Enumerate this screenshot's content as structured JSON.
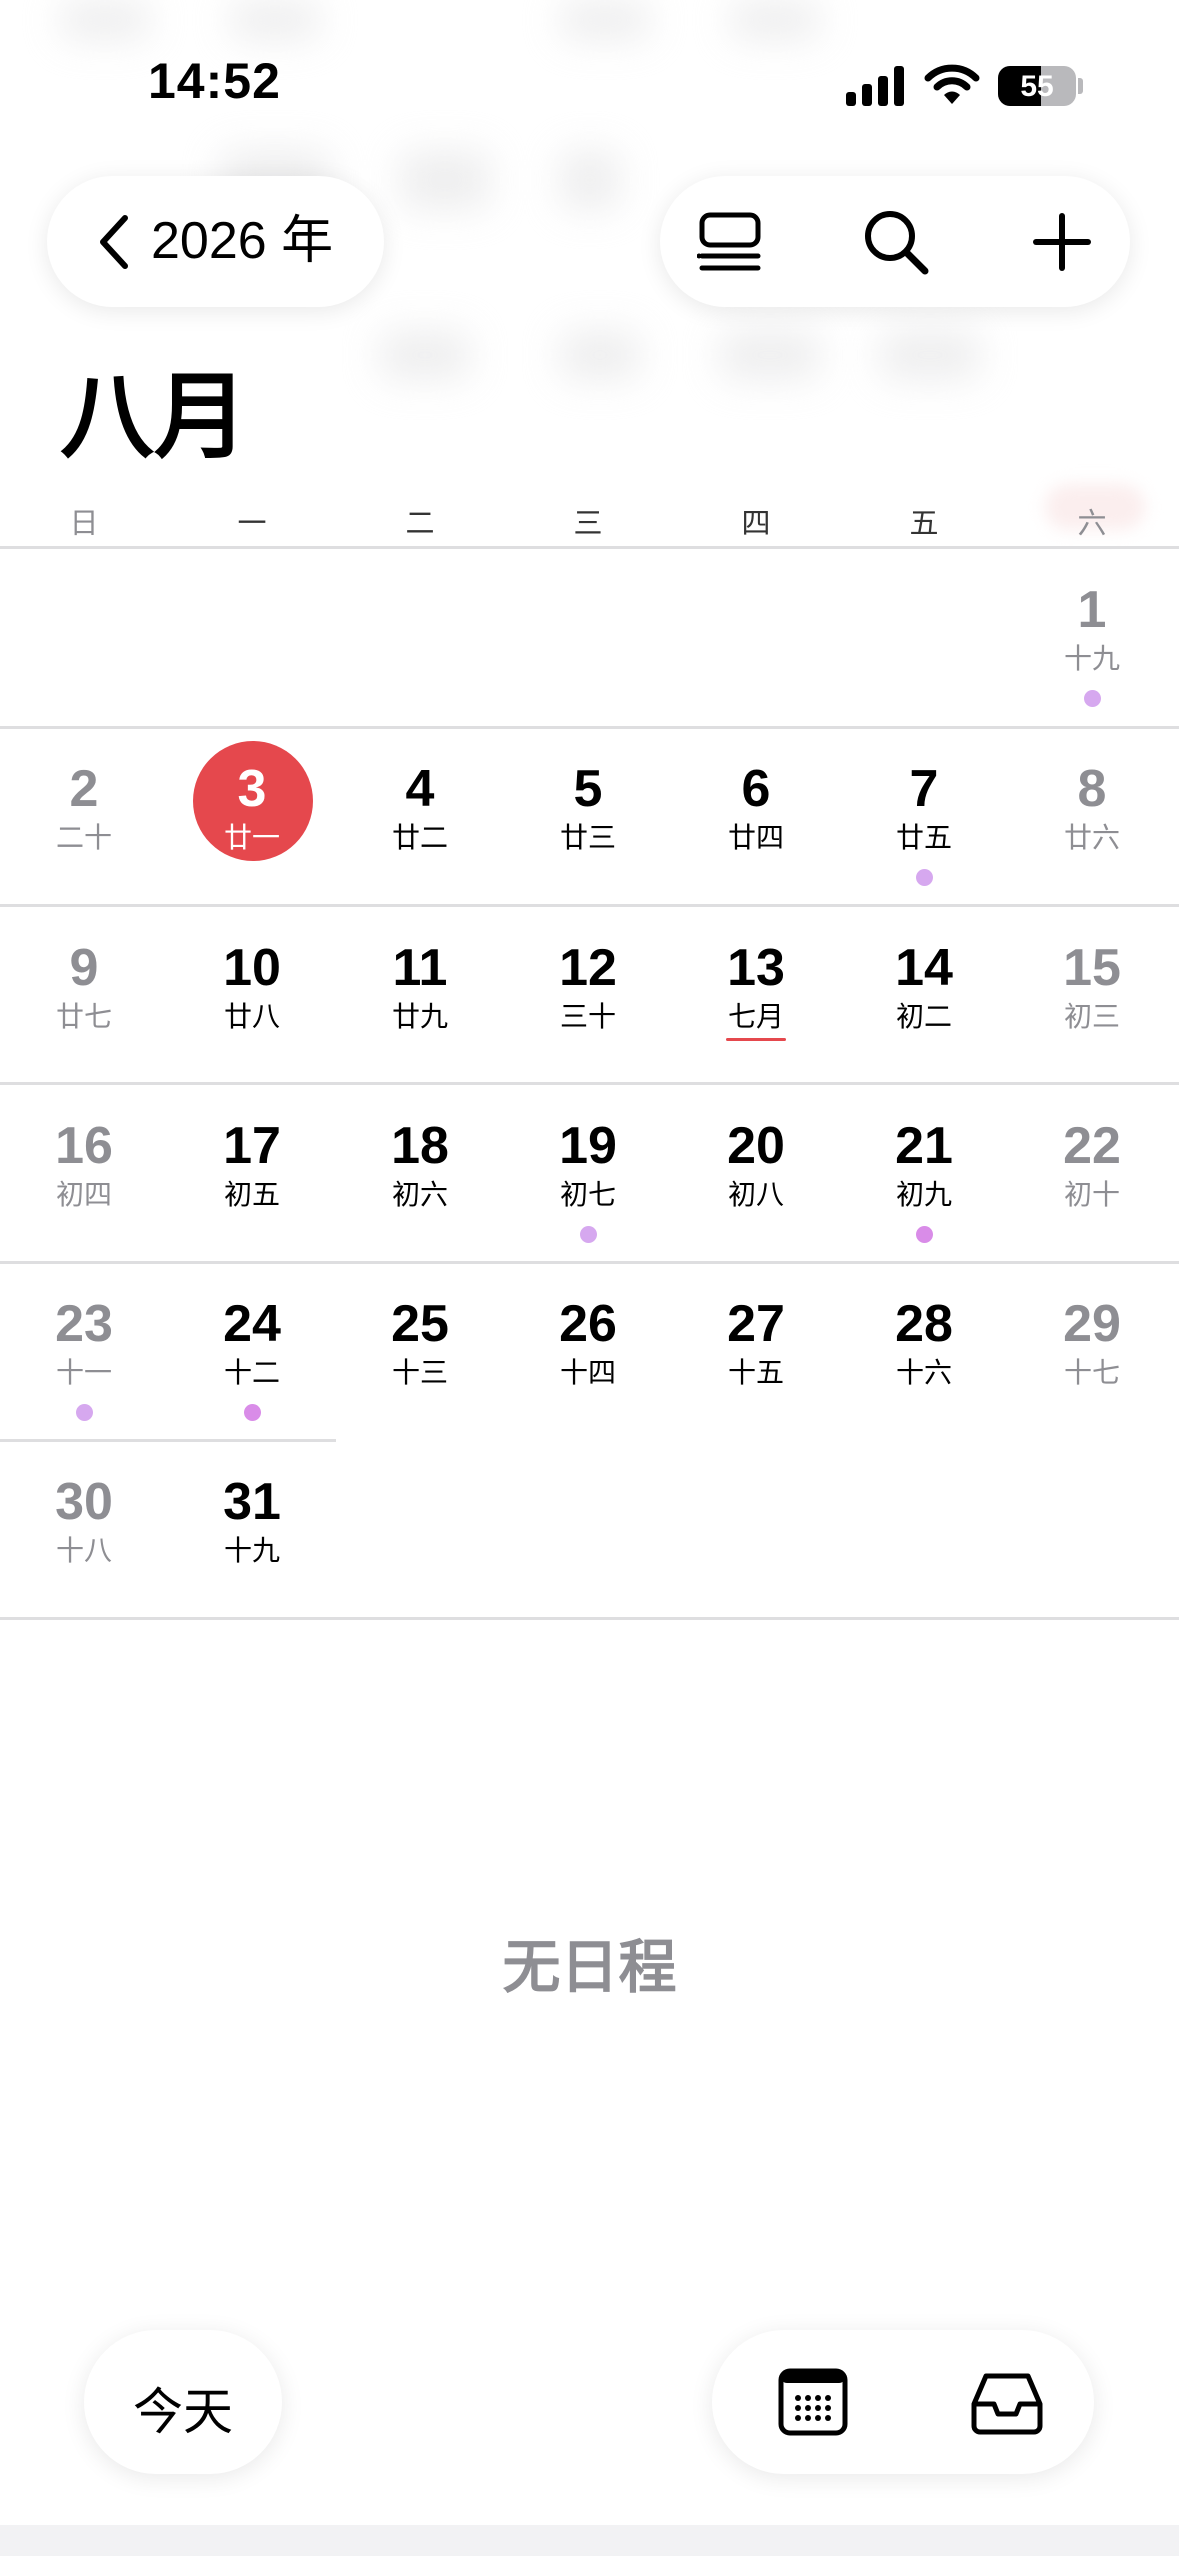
{
  "status_bar": {
    "time": "14:52",
    "battery_level": 55,
    "battery_label": "55"
  },
  "header": {
    "back_label": "2026 年",
    "tools": [
      "list-view-icon",
      "search-icon",
      "add-icon"
    ]
  },
  "month_title": "八月",
  "weekdays": [
    "日",
    "一",
    "二",
    "三",
    "四",
    "五",
    "六"
  ],
  "days": [
    {
      "day": "1",
      "lunar": "十九",
      "col": 6,
      "row": 0,
      "muted": true,
      "dot": "#d6a8ef"
    },
    {
      "day": "2",
      "lunar": "二十",
      "col": 0,
      "row": 1,
      "muted": true
    },
    {
      "day": "3",
      "lunar": "廿一",
      "col": 1,
      "row": 1,
      "today": true
    },
    {
      "day": "4",
      "lunar": "廿二",
      "col": 2,
      "row": 1
    },
    {
      "day": "5",
      "lunar": "廿三",
      "col": 3,
      "row": 1
    },
    {
      "day": "6",
      "lunar": "廿四",
      "col": 4,
      "row": 1
    },
    {
      "day": "7",
      "lunar": "廿五",
      "col": 5,
      "row": 1,
      "dot": "#d6a8ef"
    },
    {
      "day": "8",
      "lunar": "廿六",
      "col": 6,
      "row": 1,
      "muted": true
    },
    {
      "day": "9",
      "lunar": "廿七",
      "col": 0,
      "row": 2,
      "muted": true
    },
    {
      "day": "10",
      "lunar": "廿八",
      "col": 1,
      "row": 2
    },
    {
      "day": "11",
      "lunar": "廿九",
      "col": 2,
      "row": 2
    },
    {
      "day": "12",
      "lunar": "三十",
      "col": 3,
      "row": 2
    },
    {
      "day": "13",
      "lunar": "七月",
      "col": 4,
      "row": 2,
      "underline": true
    },
    {
      "day": "14",
      "lunar": "初二",
      "col": 5,
      "row": 2
    },
    {
      "day": "15",
      "lunar": "初三",
      "col": 6,
      "row": 2,
      "muted": true
    },
    {
      "day": "16",
      "lunar": "初四",
      "col": 0,
      "row": 3,
      "muted": true
    },
    {
      "day": "17",
      "lunar": "初五",
      "col": 1,
      "row": 3
    },
    {
      "day": "18",
      "lunar": "初六",
      "col": 2,
      "row": 3
    },
    {
      "day": "19",
      "lunar": "初七",
      "col": 3,
      "row": 3,
      "dot": "#d6a8ef"
    },
    {
      "day": "20",
      "lunar": "初八",
      "col": 4,
      "row": 3
    },
    {
      "day": "21",
      "lunar": "初九",
      "col": 5,
      "row": 3,
      "dot": "#d98ce8"
    },
    {
      "day": "22",
      "lunar": "初十",
      "col": 6,
      "row": 3,
      "muted": true
    },
    {
      "day": "23",
      "lunar": "十一",
      "col": 0,
      "row": 4,
      "muted": true,
      "dot": "#d6a8ef"
    },
    {
      "day": "24",
      "lunar": "十二",
      "col": 1,
      "row": 4,
      "dot": "#d98ce8"
    },
    {
      "day": "25",
      "lunar": "十三",
      "col": 2,
      "row": 4
    },
    {
      "day": "26",
      "lunar": "十四",
      "col": 3,
      "row": 4
    },
    {
      "day": "27",
      "lunar": "十五",
      "col": 4,
      "row": 4
    },
    {
      "day": "28",
      "lunar": "十六",
      "col": 5,
      "row": 4
    },
    {
      "day": "29",
      "lunar": "十七",
      "col": 6,
      "row": 4,
      "muted": true
    },
    {
      "day": "30",
      "lunar": "十八",
      "col": 0,
      "row": 5,
      "muted": true
    },
    {
      "day": "31",
      "lunar": "十九",
      "col": 1,
      "row": 5
    }
  ],
  "empty_state": "无日程",
  "bottom": {
    "today_label": "今天",
    "tools": [
      "calendar-icon",
      "inbox-icon"
    ]
  },
  "colors": {
    "today": "#e5484d",
    "muted_text": "#8e8e93",
    "event_dot": "#d6a8ef",
    "event_dot_strong": "#d98ce8"
  }
}
